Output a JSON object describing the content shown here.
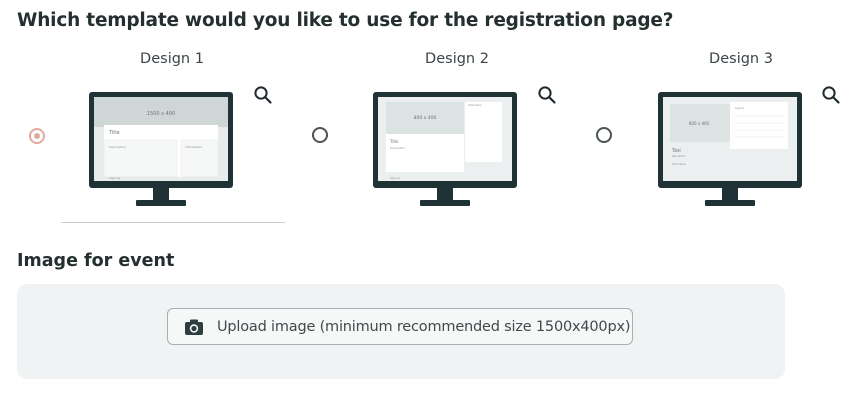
{
  "question": "Which template would you like to use for the registration page?",
  "designs": [
    {
      "label": "Design 1",
      "selected": true,
      "preview": {
        "banner": "1500 x 400",
        "title": "Title",
        "text_left": "Description",
        "text_right": "Information",
        "footer": "Sign up"
      }
    },
    {
      "label": "Design 2",
      "selected": false,
      "preview": {
        "banner": "800 x 400",
        "title": "Title",
        "subtitle": "Description",
        "side_label": "Information",
        "footer": "Sign up"
      }
    },
    {
      "label": "Design 3",
      "selected": false,
      "preview": {
        "banner": "800 x 400",
        "title": "Titel",
        "side_label": "Layout",
        "line1": "Description",
        "line2": "Information"
      }
    }
  ],
  "image_section": {
    "heading": "Image for event",
    "upload_label": "Upload image (minimum recommended size 1500x400px)",
    "upload_icon": "camera-icon"
  },
  "colors": {
    "monitor_frame": "#1f3337",
    "radio_selected": "#e2a9a0",
    "upload_area_bg": "#f1f2f3"
  }
}
